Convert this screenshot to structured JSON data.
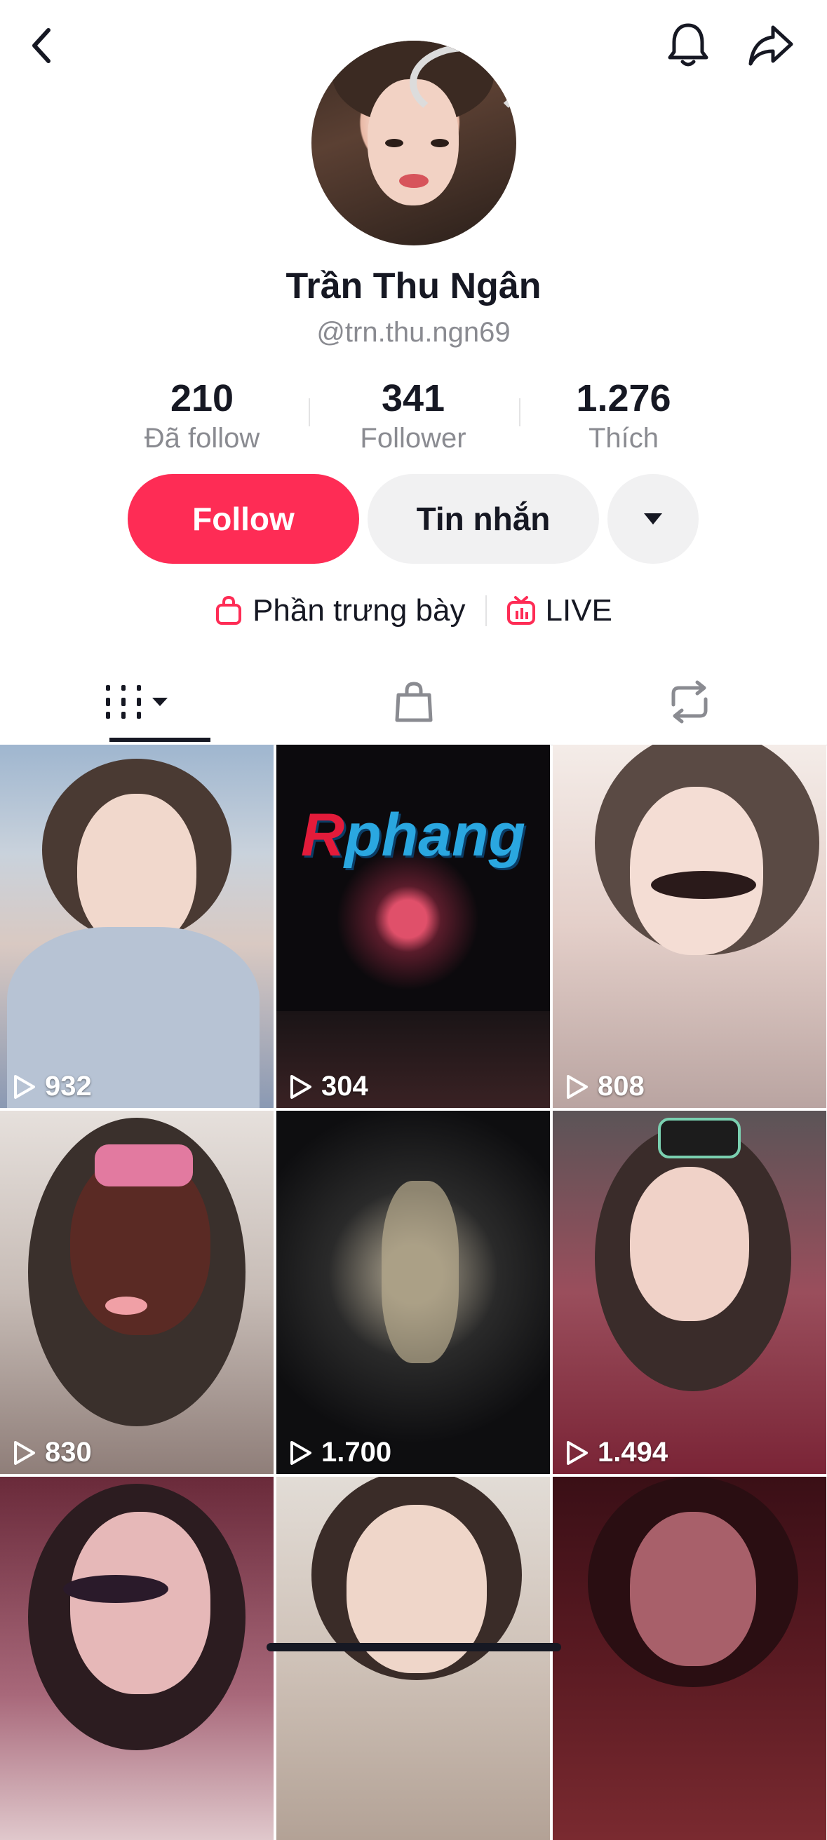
{
  "header": {
    "back_icon": "chevron-left-icon",
    "bell_icon": "bell-icon",
    "share_icon": "share-arrow-icon"
  },
  "profile": {
    "display_name": "Trần Thu Ngân",
    "username": "@trn.thu.ngn69"
  },
  "stats": [
    {
      "value": "210",
      "label": "Đã follow"
    },
    {
      "value": "341",
      "label": "Follower"
    },
    {
      "value": "1.276",
      "label": "Thích"
    }
  ],
  "actions": {
    "follow_label": "Follow",
    "message_label": "Tin nhắn",
    "more_icon": "caret-down-icon"
  },
  "links": {
    "showcase_label": "Phần trưng bày",
    "live_label": "LIVE"
  },
  "tabs": [
    {
      "icon": "grid-videos-icon",
      "selected": true
    },
    {
      "icon": "shopping-bag-icon",
      "selected": false
    },
    {
      "icon": "repost-icon",
      "selected": false
    }
  ],
  "videos": [
    {
      "views": "932"
    },
    {
      "views": "304",
      "overlay_text": "Rphang"
    },
    {
      "views": "808"
    },
    {
      "views": "830"
    },
    {
      "views": "1.700"
    },
    {
      "views": "1.494"
    },
    {
      "views": ""
    },
    {
      "views": ""
    },
    {
      "views": ""
    }
  ],
  "colors": {
    "accent": "#fe2c55",
    "text": "#161823",
    "muted": "#8a8b91"
  }
}
